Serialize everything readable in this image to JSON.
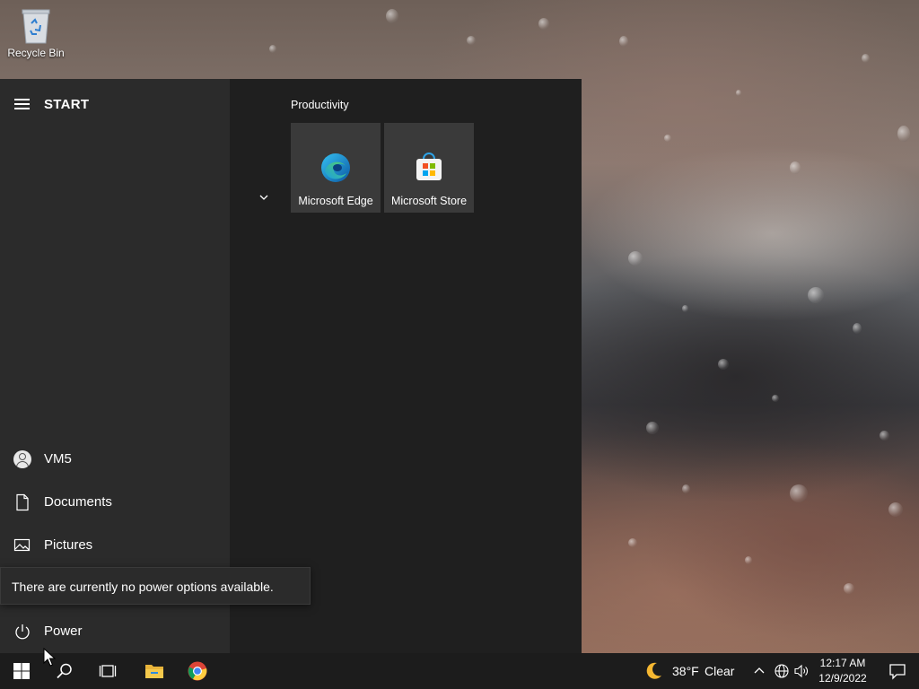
{
  "desktop": {
    "recycle_bin_label": "Recycle Bin"
  },
  "start_menu": {
    "title": "START",
    "rail_items": [
      {
        "label": "VM5",
        "icon": "user-avatar-icon"
      },
      {
        "label": "Documents",
        "icon": "document-icon"
      },
      {
        "label": "Pictures",
        "icon": "pictures-icon"
      },
      {
        "label": "Power",
        "icon": "power-icon"
      }
    ],
    "tooltip": "There are currently no power options available.",
    "group_title": "Productivity",
    "tiles": [
      {
        "label": "Microsoft Edge",
        "icon": "edge-icon"
      },
      {
        "label": "Microsoft Store",
        "icon": "store-icon"
      }
    ]
  },
  "taskbar": {
    "weather_temp": "38°F",
    "weather_condition": "Clear",
    "time": "12:17 AM",
    "date": "12/9/2022"
  },
  "colors": {
    "start_bg": "#1f1f1f",
    "rail_bg": "#2b2b2b",
    "tile_bg": "#3a3a3a",
    "taskbar_bg": "#1c1c1c",
    "accent_blue": "#0078d4"
  }
}
